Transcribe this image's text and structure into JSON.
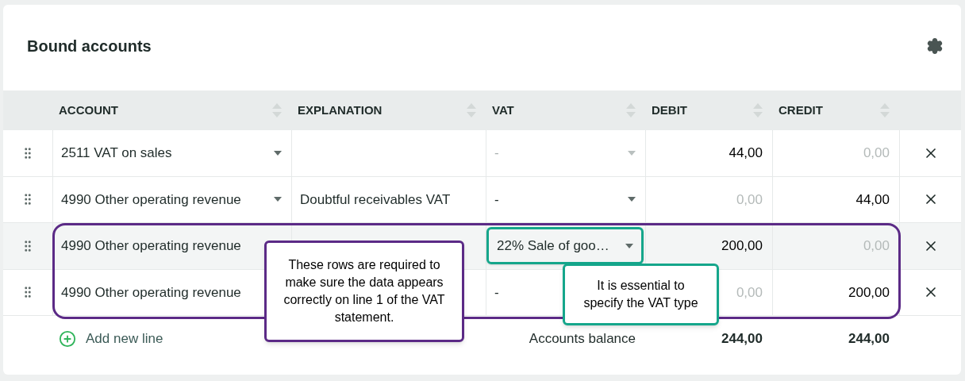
{
  "title": "Bound accounts",
  "columns": [
    {
      "label": "ACCOUNT"
    },
    {
      "label": "EXPLANATION"
    },
    {
      "label": "VAT"
    },
    {
      "label": "DEBIT"
    },
    {
      "label": "CREDIT"
    }
  ],
  "rows": [
    {
      "account": "2511 VAT on sales",
      "explanation": "",
      "vat": {
        "text": "-",
        "disabled": true,
        "highlighted": false
      },
      "debit": {
        "text": "44,00",
        "muted": false
      },
      "credit": {
        "text": "0,00",
        "muted": true
      },
      "hovered": false
    },
    {
      "account": "4990 Other operating revenue",
      "explanation": "Doubtful receivables VAT",
      "vat": {
        "text": "-",
        "disabled": false,
        "highlighted": false
      },
      "debit": {
        "text": "0,00",
        "muted": true
      },
      "credit": {
        "text": "44,00",
        "muted": false
      },
      "hovered": false
    },
    {
      "account": "4990 Other operating revenue",
      "explanation": "",
      "vat": {
        "text": "22% Sale of goo…",
        "disabled": false,
        "highlighted": true
      },
      "debit": {
        "text": "200,00",
        "muted": false
      },
      "credit": {
        "text": "0,00",
        "muted": true
      },
      "hovered": true
    },
    {
      "account": "4990 Other operating revenue",
      "explanation": "",
      "vat": {
        "text": "-",
        "disabled": false,
        "highlighted": false
      },
      "debit": {
        "text": "0,00",
        "muted": true
      },
      "credit": {
        "text": "200,00",
        "muted": false
      },
      "hovered": false
    }
  ],
  "add_line": "Add new line",
  "balance": {
    "label": "Accounts balance",
    "debit": "244,00",
    "credit": "244,00"
  },
  "callouts": [
    {
      "kind": "rows",
      "text": "These rows are required to make sure the data appears correctly on line 1 of the VAT statement."
    },
    {
      "kind": "vat",
      "text": "It is essential to specify the VAT type"
    }
  ]
}
